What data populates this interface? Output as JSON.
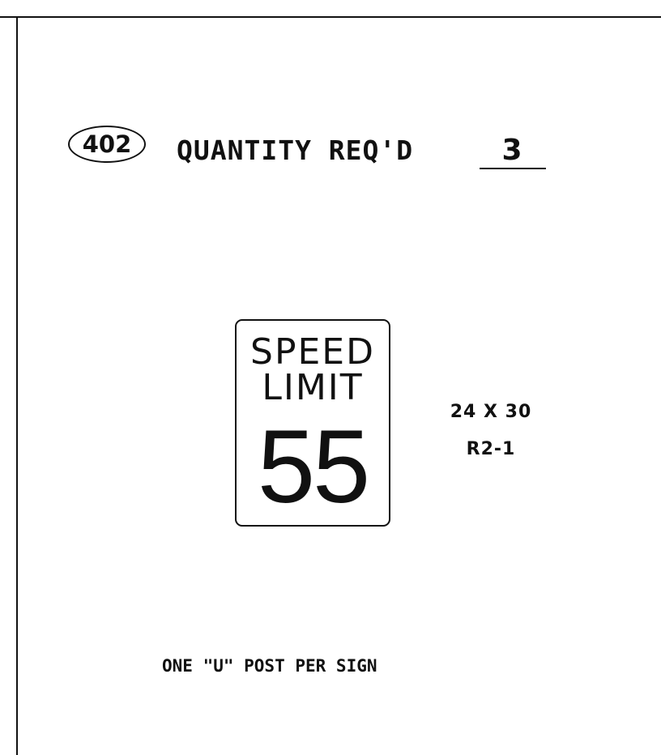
{
  "item": {
    "number": "402",
    "quantity_label": "QUANTITY REQ'D",
    "quantity_value": "3"
  },
  "sign": {
    "line1": "SPEED",
    "line2": "LIMIT",
    "number": "55",
    "size": "24 X 30",
    "code": "R2-1"
  },
  "note": "ONE \"U\" POST PER SIGN"
}
